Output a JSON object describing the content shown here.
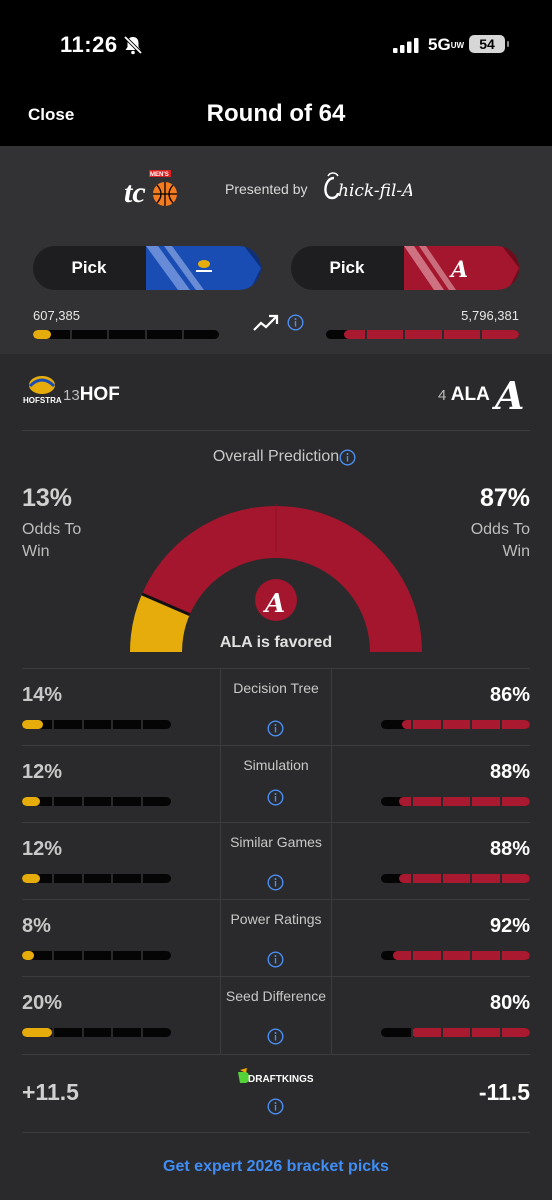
{
  "status_bar": {
    "time": "11:26",
    "network": "5G",
    "network_sub": "UW",
    "battery": "54"
  },
  "header": {
    "close_label": "Close",
    "title": "Round of 64"
  },
  "sponsor": {
    "presented_by": "Presented by"
  },
  "picks": {
    "left": {
      "label": "Pick",
      "count": "607,385",
      "team_color": "#1a4db3",
      "share": 0.095
    },
    "right": {
      "label": "Pick",
      "count": "5,796,381",
      "team_color": "#a3162d",
      "share": 0.905
    }
  },
  "teams": {
    "left": {
      "seed": "13",
      "abbr": "HOF",
      "color": "#e5ac0c"
    },
    "right": {
      "seed": "4",
      "abbr": "ALA",
      "color": "#a91a30"
    }
  },
  "overall": {
    "label": "Overall Prediction",
    "left_pct": "13%",
    "right_pct": "87%",
    "left_value": 13,
    "right_value": 87,
    "odds_label": "Odds To",
    "odds_label_2": "Win",
    "favored_text": "ALA is favored"
  },
  "models": [
    {
      "name": "Decision Tree",
      "left": "14%",
      "right": "86%",
      "left_value": 14,
      "right_value": 86
    },
    {
      "name": "Simulation",
      "left": "12%",
      "right": "88%",
      "left_value": 12,
      "right_value": 88
    },
    {
      "name": "Similar Games",
      "left": "12%",
      "right": "88%",
      "left_value": 12,
      "right_value": 88
    },
    {
      "name": "Power Ratings",
      "left": "8%",
      "right": "92%",
      "left_value": 8,
      "right_value": 92
    },
    {
      "name": "Seed Difference",
      "left": "20%",
      "right": "80%",
      "left_value": 20,
      "right_value": 80
    }
  ],
  "spread": {
    "left": "+11.5",
    "right": "-11.5",
    "sportsbook": "DRAFTKINGS"
  },
  "footer": {
    "expert_link": "Get expert 2026 bracket picks"
  },
  "icons": [
    "bell-slash-icon",
    "signal-icon",
    "battery-icon",
    "trend-up-icon",
    "info-icon",
    "hofstra-logo",
    "alabama-logo",
    "tc-logo",
    "chick-fil-a-logo",
    "draftkings-logo"
  ]
}
